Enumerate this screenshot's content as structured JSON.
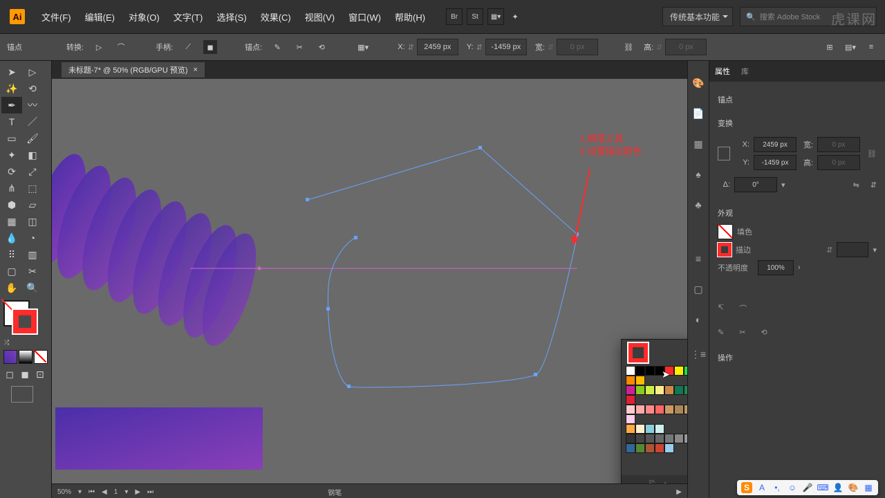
{
  "app": {
    "logo": "Ai"
  },
  "menubar": [
    "文件(F)",
    "编辑(E)",
    "对象(O)",
    "文字(T)",
    "选择(S)",
    "效果(C)",
    "视图(V)",
    "窗口(W)",
    "帮助(H)"
  ],
  "workspace": "传统基本功能",
  "search_placeholder": "搜索 Adobe Stock",
  "control": {
    "label_anchor": "锚点",
    "convert": "转换:",
    "handle": "手柄:",
    "anchor_lbl": "锚点:",
    "x_label": "X:",
    "x_value": "2459 px",
    "y_label": "Y:",
    "y_value": "-1459 px",
    "w_label": "宽:",
    "w_value": "0 px",
    "h_label": "高:",
    "h_value": "0 px"
  },
  "document_tab": "未标题-7* @ 50% (RGB/GPU 预览)",
  "canvas_annot": {
    "line1": "1.钢笔工具",
    "line2": "2.设置描边颜色"
  },
  "swatches": {
    "rows": [
      [
        "#ffffff",
        "#000000",
        "#000000",
        "#000000",
        "#ff2a2a",
        "#ffee00",
        "#22dd44",
        "#00cc99",
        "#00aaff",
        "#2233ff",
        "#aa22ff",
        "#ff22aa",
        "#ff0000",
        "#ff4400",
        "#ff8800",
        "#ffbb00"
      ],
      [
        "#cc2299",
        "#88cc22",
        "#ccee44",
        "#ffee88",
        "#cc8844",
        "#117755",
        "#228855",
        "#339988",
        "#44aadd",
        "#5566cc",
        "#6644aa",
        "#884499",
        "#aa3377",
        "#cc2255",
        "#dd2233"
      ],
      [
        "#ffcccc",
        "#ffaaaa",
        "#ff8888",
        "#ff6666",
        "#cc9966",
        "#aa8855",
        "#bb9966",
        "#ccaa77",
        "#ddbb88",
        "#ccbb99",
        "#ffffff",
        "#eeeeee",
        "#0088ff",
        "#55aaff",
        "#ffccee"
      ],
      [
        "#ffaa44",
        "#ffeecc",
        "#88ccdd",
        "#cceeee"
      ],
      [
        "#333333",
        "#444444",
        "#555555",
        "#666666",
        "#777777",
        "#888888",
        "#999999",
        "#aaaaaa",
        "#bbbbbb",
        "#cccccc",
        "#dddddd",
        "#eeeeee"
      ],
      [
        "#336699",
        "#558833",
        "#aa5533",
        "#cc4433",
        "#99ccee"
      ]
    ]
  },
  "props": {
    "tab_props": "属性",
    "tab_lib": "库",
    "section_anchor": "锚点",
    "section_transform": "变换",
    "x_lbl": "X:",
    "x_val": "2459 px",
    "y_lbl": "Y:",
    "y_val": "-1459 px",
    "w_lbl": "宽:",
    "w_val": "0 px",
    "h_lbl": "高:",
    "h_val": "0 px",
    "angle_lbl": "Δ:",
    "angle_val": "0°",
    "section_appearance": "外观",
    "fill_label": "填色",
    "stroke_label": "描边",
    "opacity_label": "不透明度",
    "opacity_value": "100%",
    "section_actions": "操作"
  },
  "status": {
    "zoom": "50%",
    "page": "1",
    "tool": "钢笔"
  },
  "watermark": "虎课网"
}
